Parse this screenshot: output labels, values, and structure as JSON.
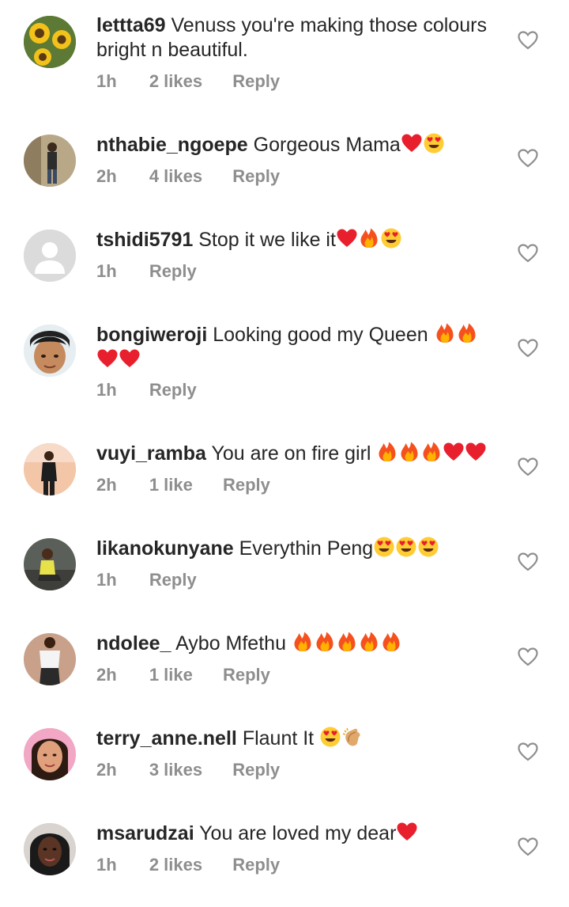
{
  "comments": [
    {
      "username": "lettta69",
      "message": "Venuss  you're making  those colours  bright n beautiful.",
      "emojis": [],
      "time": "1h",
      "likes": "2 likes",
      "reply": "Reply",
      "avatar": "sunflower-avatar"
    },
    {
      "username": "nthabie_ngoepe",
      "message": "Gorgeous Mama",
      "emojis": [
        "red-heart",
        "heart-eyes"
      ],
      "time": "2h",
      "likes": "4 likes",
      "reply": "Reply",
      "avatar": "person-avatar"
    },
    {
      "username": "tshidi5791",
      "message": "Stop it we like it",
      "emojis": [
        "red-heart",
        "fire",
        "heart-eyes"
      ],
      "time": "1h",
      "likes": "",
      "reply": "Reply",
      "avatar": "default-avatar"
    },
    {
      "username": "bongiweroji",
      "message": "Looking good my Queen ",
      "emojis": [
        "fire",
        "fire",
        "red-heart",
        "red-heart"
      ],
      "time": "1h",
      "likes": "",
      "reply": "Reply",
      "avatar": "person-avatar"
    },
    {
      "username": "vuyi_ramba",
      "message": "You are on fire girl ",
      "emojis": [
        "fire",
        "fire",
        "fire",
        "red-heart",
        "red-heart"
      ],
      "time": "2h",
      "likes": "1 like",
      "reply": "Reply",
      "avatar": "person-avatar"
    },
    {
      "username": "likanokunyane",
      "message": "Everythin Peng",
      "emojis": [
        "heart-eyes",
        "heart-eyes",
        "heart-eyes"
      ],
      "time": "1h",
      "likes": "",
      "reply": "Reply",
      "avatar": "person-avatar"
    },
    {
      "username": "ndolee_",
      "message": "Aybo Mfethu ",
      "emojis": [
        "fire",
        "fire",
        "fire",
        "fire",
        "fire"
      ],
      "time": "2h",
      "likes": "1 like",
      "reply": "Reply",
      "avatar": "person-avatar"
    },
    {
      "username": "terry_anne.nell",
      "message": "Flaunt It ",
      "emojis": [
        "heart-eyes",
        "clapping-hands"
      ],
      "time": "2h",
      "likes": "3 likes",
      "reply": "Reply",
      "avatar": "person-avatar"
    },
    {
      "username": "msarudzai",
      "message": "You are loved my dear",
      "emojis": [
        "red-heart"
      ],
      "time": "1h",
      "likes": "2 likes",
      "reply": "Reply",
      "avatar": "person-avatar"
    }
  ],
  "colors": {
    "text": "#262626",
    "muted": "#8e8e8e",
    "heart_outline": "#8e8e8e",
    "red_heart": "#e8202e",
    "fire_outer": "#f5511e",
    "fire_inner": "#ffb300",
    "smiley": "#ffcc33"
  }
}
